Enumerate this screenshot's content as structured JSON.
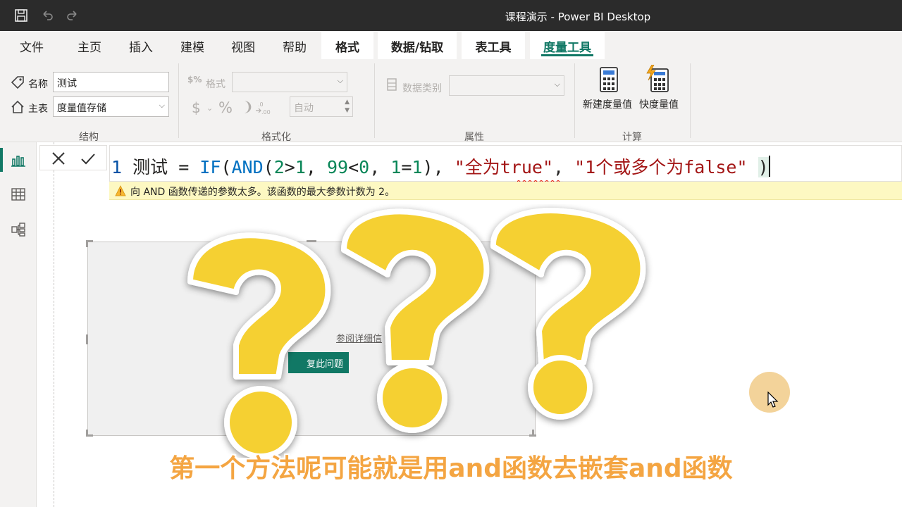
{
  "window": {
    "title": "课程演示 - Power BI Desktop"
  },
  "tabs": [
    {
      "label": "文件"
    },
    {
      "label": "主页"
    },
    {
      "label": "插入"
    },
    {
      "label": "建模"
    },
    {
      "label": "视图"
    },
    {
      "label": "帮助"
    },
    {
      "label": "格式"
    },
    {
      "label": "数据/钻取"
    },
    {
      "label": "表工具"
    },
    {
      "label": "度量工具",
      "active": true
    }
  ],
  "ribbon": {
    "structure": {
      "group_label": "结构",
      "name_label": "名称",
      "name_value": "测试",
      "home_table_label": "主表",
      "home_table_value": "度量值存储"
    },
    "formatting": {
      "group_label": "格式化",
      "format_label": "格式",
      "currency_symbol": "$",
      "percent_symbol": "%",
      "comma_symbol": "❩",
      "decimal_value": "自动"
    },
    "properties": {
      "group_label": "属性",
      "data_category_label": "数据类别"
    },
    "calculations": {
      "group_label": "计算",
      "new_measure_label": "新建度量值",
      "quick_measure_label": "快度量值"
    }
  },
  "formula": {
    "line_number": "1",
    "measure_name": "测试",
    "eq": " = ",
    "fn_if": "IF",
    "fn_and": "AND",
    "p_open": "(",
    "n2": "2",
    "gt": ">",
    "n1": "1",
    "comma": ", ",
    "n99": "99",
    "lt": "<",
    "n0": "0",
    "n1b": "1",
    "eqsign": "=",
    "n1c": "1",
    "p_close": ")",
    "str_true": "\"全为true\"",
    "str_false": "\"1个或多个为false\"",
    "final_paren": ")",
    "error_message": "向 AND 函数传递的参数太多。该函数的最大参数计数为 2。"
  },
  "visual": {
    "link_text": "参阅详细信",
    "button_text": "复此问题"
  },
  "subtitle": "第一个方法呢可能就是用and函数去嵌套and函数",
  "colors": {
    "accent": "#117865",
    "question_mark": "#f5d033",
    "subtitle": "#f4a542"
  }
}
